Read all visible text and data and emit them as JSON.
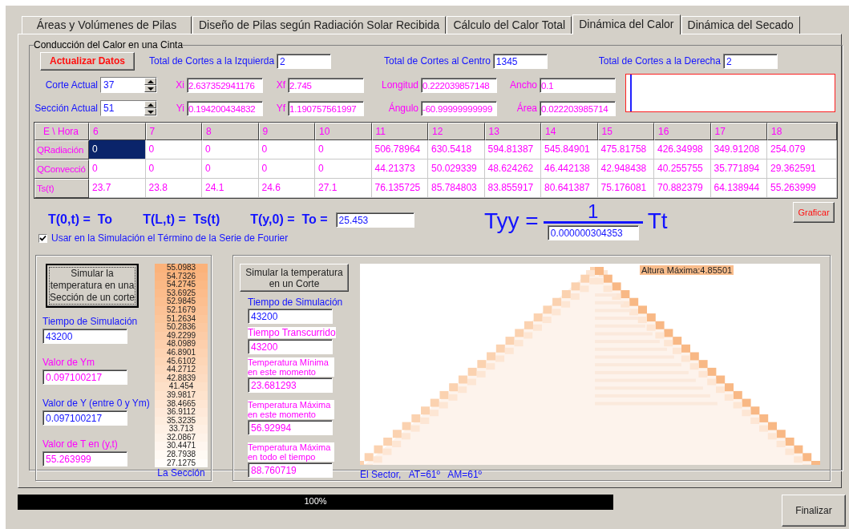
{
  "tabs": [
    {
      "label": "Áreas y Volúmenes de Pilas",
      "selected": false
    },
    {
      "label": "Diseño de Pilas según Radiación Solar Recibida",
      "selected": false
    },
    {
      "label": "Cálculo del Calor Total",
      "selected": false
    },
    {
      "label": "Dinámica del Calor",
      "selected": true
    },
    {
      "label": "Dinámica del Secado",
      "selected": false
    }
  ],
  "group_title": "Conducción del Calor en una Cinta",
  "update_button": "Actualizar Datos",
  "totals": [
    {
      "label": "Total de Cortes a la Izquierda",
      "value": "2"
    },
    {
      "label": "Total de Cortes al Centro",
      "value": "1345"
    },
    {
      "label": "Total de Cortes a la Derecha",
      "value": "2"
    }
  ],
  "geometry_rows": [
    {
      "spinner": {
        "label": "Corte Actual",
        "value": "37"
      },
      "fields": [
        {
          "label": "Xi",
          "value": "2.637352941176"
        },
        {
          "label": "Xf",
          "value": "2.745"
        },
        {
          "label": "Longitud",
          "value": "0.222039857148"
        },
        {
          "label": "Ancho",
          "value": "0.1"
        }
      ]
    },
    {
      "spinner": {
        "label": "Sección Actual",
        "value": "51"
      },
      "fields": [
        {
          "label": "Yi",
          "value": "0.194200434832"
        },
        {
          "label": "Yf",
          "value": "1.190757561997"
        },
        {
          "label": "Ángulo",
          "value": "-60.99999999999"
        },
        {
          "label": "Área",
          "value": "0.022203985714"
        }
      ]
    }
  ],
  "table": {
    "corner": "E \\ Hora",
    "columns": [
      "6",
      "7",
      "8",
      "9",
      "10",
      "11",
      "12",
      "13",
      "14",
      "15",
      "16",
      "17",
      "18"
    ],
    "rows": [
      {
        "label": "QRadiación",
        "cells": [
          {
            "text": "0",
            "selected": true
          },
          {
            "text": "0",
            "selected": false
          },
          {
            "text": "0",
            "selected": false
          },
          {
            "text": "0",
            "selected": false
          },
          {
            "text": "0",
            "selected": false
          },
          {
            "text": "506.78964",
            "selected": false
          },
          {
            "text": "630.5418",
            "selected": false
          },
          {
            "text": "594.81387",
            "selected": false
          },
          {
            "text": "545.84901",
            "selected": false
          },
          {
            "text": "475.81758",
            "selected": false
          },
          {
            "text": "426.34998",
            "selected": false
          },
          {
            "text": "349.91208",
            "selected": false
          },
          {
            "text": "254.079",
            "selected": false
          }
        ]
      },
      {
        "label": "QConvecció",
        "cells": [
          {
            "text": "0",
            "selected": false
          },
          {
            "text": "0",
            "selected": false
          },
          {
            "text": "0",
            "selected": false
          },
          {
            "text": "0",
            "selected": false
          },
          {
            "text": "0",
            "selected": false
          },
          {
            "text": "44.21373",
            "selected": false
          },
          {
            "text": "50.029339",
            "selected": false
          },
          {
            "text": "48.624262",
            "selected": false
          },
          {
            "text": "46.442138",
            "selected": false
          },
          {
            "text": "42.948438",
            "selected": false
          },
          {
            "text": "40.255755",
            "selected": false
          },
          {
            "text": "35.771894",
            "selected": false
          },
          {
            "text": "29.362591",
            "selected": false
          }
        ]
      },
      {
        "label": "Ts(t)",
        "cells": [
          {
            "text": "23.7",
            "selected": false
          },
          {
            "text": "23.8",
            "selected": false
          },
          {
            "text": "24.1",
            "selected": false
          },
          {
            "text": "24.6",
            "selected": false
          },
          {
            "text": "27.1",
            "selected": false
          },
          {
            "text": "76.135725",
            "selected": false
          },
          {
            "text": "85.784803",
            "selected": false
          },
          {
            "text": "83.855917",
            "selected": false
          },
          {
            "text": "80.641387",
            "selected": false
          },
          {
            "text": "75.176081",
            "selected": false
          },
          {
            "text": "70.882379",
            "selected": false
          },
          {
            "text": "64.138944",
            "selected": false
          },
          {
            "text": "55.263999",
            "selected": false
          }
        ]
      }
    ]
  },
  "formulas": [
    "T(0,t) =  To",
    "T(L,t) =  Ts(t)",
    "T(y,0) =  To ="
  ],
  "to_value": "25.453",
  "tyy": {
    "lhs": "Tyy =",
    "numerator": "1",
    "denominator": "0.000000304353",
    "rhs": "Tt"
  },
  "plot_button": "Graficar",
  "fourier": {
    "label": "Usar en la Simulación el Término de la Serie de Fourier",
    "checked": true
  },
  "section_panel": {
    "button": "Simular la temperatura en una Sección de un corte",
    "fields": [
      {
        "label": "Tiempo de Simulación",
        "value": "43200",
        "color": "#1414ff"
      },
      {
        "label": "Valor de Ym",
        "value": "0.097100217",
        "color": "#ff00ff"
      },
      {
        "label": "Valor de Y (entre 0 y Ym)",
        "value": "0.097100217",
        "color": "#1414ff"
      },
      {
        "label": "Valor de T en (y,t)",
        "value": "55.263999",
        "color": "#ff00ff"
      }
    ]
  },
  "section_values": [
    "55.0983",
    "54.7326",
    "54.2745",
    "53.6925",
    "52.9845",
    "52.1679",
    "51.2634",
    "50.2836",
    "49.2299",
    "48.0989",
    "46.8901",
    "45.6102",
    "44.2712",
    "42.8839",
    "41.454",
    "39.9817",
    "38.4665",
    "36.9112",
    "35.3235",
    "33.713",
    "32.0867",
    "30.4471",
    "28.7938",
    "27.1275"
  ],
  "section_caption": "La Sección",
  "cut_panel": {
    "button": "Simular la temperatura en un Corte",
    "fields": [
      {
        "label": "Tiempo de Simulación",
        "value": "43200",
        "color": "#1414ff"
      },
      {
        "label": "Tiempo Transcurrido",
        "value": "43200",
        "color": "#ff00ff"
      },
      {
        "label": "Temperatura Mínima en este momento",
        "value": "23.681293",
        "color": "#ff00ff"
      },
      {
        "label": "Temperatura Máxima en este momento",
        "value": "56.92994",
        "color": "#ff00ff"
      },
      {
        "label": "Temperatura Máxima en todo el tiempo",
        "value": "88.760719",
        "color": "#ff00ff"
      }
    ]
  },
  "sector": {
    "max_height": "Altura Máxima:4.85501",
    "caption": "El Sector,   AT=61º   AM=61º"
  },
  "progress": {
    "level": 1,
    "text": "100%"
  },
  "finish_button": "Finalizar"
}
